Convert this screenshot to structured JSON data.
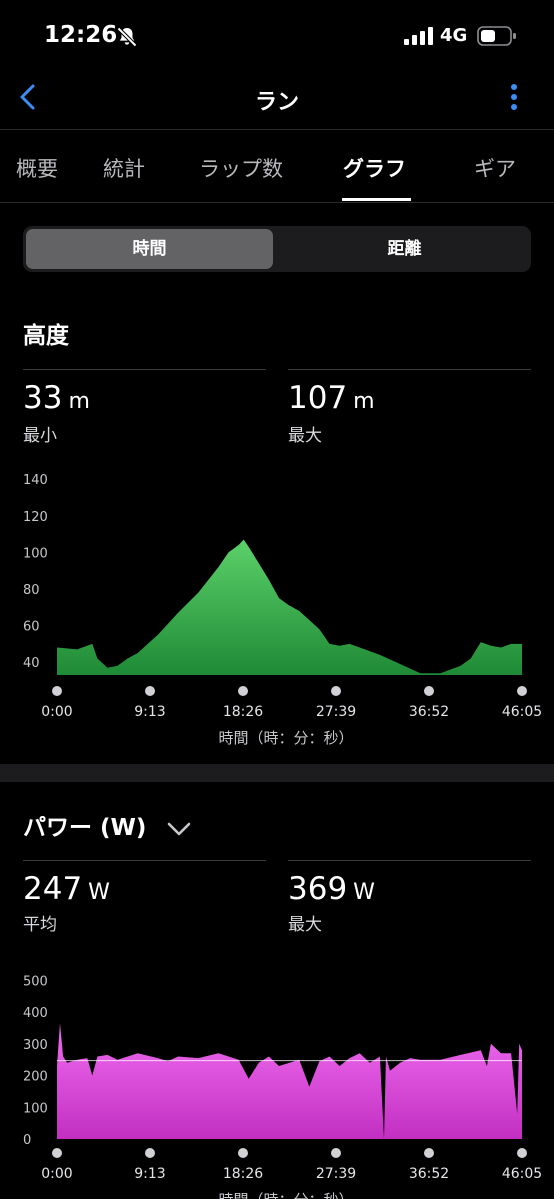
{
  "status": {
    "time": "12:26",
    "network": "4G",
    "icons": [
      "bell-slash-icon",
      "signal-icon",
      "battery-icon"
    ]
  },
  "nav": {
    "title": "ラン",
    "back_icon": "chevron-left-icon",
    "more_icon": "vertical-ellipsis-icon"
  },
  "tabs": [
    {
      "label": "概要"
    },
    {
      "label": "統計"
    },
    {
      "label": "ラップ数"
    },
    {
      "label": "グラフ",
      "active": true
    },
    {
      "label": "ギア"
    }
  ],
  "segmented": {
    "options": [
      "時間",
      "距離"
    ],
    "selected": "時間"
  },
  "elevation": {
    "title": "高度",
    "min": {
      "value": "33",
      "unit": "m",
      "label": "最小"
    },
    "max": {
      "value": "107",
      "unit": "m",
      "label": "最大"
    },
    "x_axis_title": "時間（時：分：秒）"
  },
  "power": {
    "title": "パワー (W)",
    "avg": {
      "value": "247",
      "unit": "W",
      "label": "平均"
    },
    "max": {
      "value": "369",
      "unit": "W",
      "label": "最大"
    },
    "x_axis_title": "時間（時：分：秒）"
  },
  "colors": {
    "accent": "#3a8ef6",
    "elevation_fill_top": "#5cd16a",
    "elevation_fill_bottom": "#1f8a36",
    "power_fill_top": "#f06df0",
    "power_fill_bottom": "#c22fc2"
  },
  "chart_data": [
    {
      "type": "area",
      "title": "高度",
      "xlabel": "時間（時：分：秒）",
      "ylabel": "",
      "x_ticks": [
        "0:00",
        "9:13",
        "18:26",
        "27:39",
        "36:52",
        "46:05"
      ],
      "y_ticks": [
        40,
        60,
        80,
        100,
        120,
        140
      ],
      "ylim": [
        33,
        145
      ],
      "x_minutes": [
        0,
        2,
        3.5,
        4,
        5,
        6,
        7,
        8,
        10,
        12,
        14,
        16,
        17,
        18,
        18.5,
        19,
        20,
        21,
        22,
        23,
        24,
        26,
        27,
        28,
        29,
        30,
        32,
        34,
        36,
        37,
        38,
        40,
        41,
        42,
        43,
        44,
        45,
        46.08
      ],
      "values": [
        48,
        47,
        50,
        42,
        37,
        38,
        42,
        45,
        55,
        67,
        78,
        92,
        100,
        104,
        107,
        103,
        94,
        85,
        75,
        71,
        68,
        58,
        50,
        49,
        50,
        48,
        44,
        39,
        34,
        34,
        34,
        38,
        42,
        51,
        49,
        48,
        50,
        50
      ],
      "grid": false
    },
    {
      "type": "area",
      "title": "パワー (W)",
      "xlabel": "時間（時：分：秒）",
      "ylabel": "",
      "x_ticks": [
        "0:00",
        "9:13",
        "18:26",
        "27:39",
        "36:52",
        "46:05"
      ],
      "y_ticks": [
        0,
        100,
        200,
        300,
        400,
        500
      ],
      "ylim": [
        0,
        520
      ],
      "x_minutes": [
        0,
        0.3,
        0.6,
        1,
        2,
        3,
        3.5,
        4,
        5,
        6,
        8,
        10,
        11,
        12,
        14,
        16,
        18,
        19,
        20,
        21,
        22,
        24,
        25,
        26,
        27,
        28,
        29,
        30,
        31,
        32,
        32.4,
        32.6,
        33,
        34,
        35,
        36,
        38,
        40,
        42,
        42.6,
        43,
        44,
        45,
        45.6,
        45.8,
        46.08
      ],
      "values": [
        230,
        365,
        260,
        240,
        250,
        255,
        200,
        260,
        265,
        250,
        270,
        255,
        245,
        260,
        255,
        270,
        250,
        190,
        240,
        260,
        230,
        250,
        165,
        245,
        260,
        230,
        255,
        270,
        240,
        260,
        0,
        260,
        215,
        240,
        255,
        250,
        250,
        265,
        280,
        230,
        300,
        270,
        270,
        80,
        300,
        280
      ],
      "reference_line": 247,
      "grid": false
    }
  ]
}
